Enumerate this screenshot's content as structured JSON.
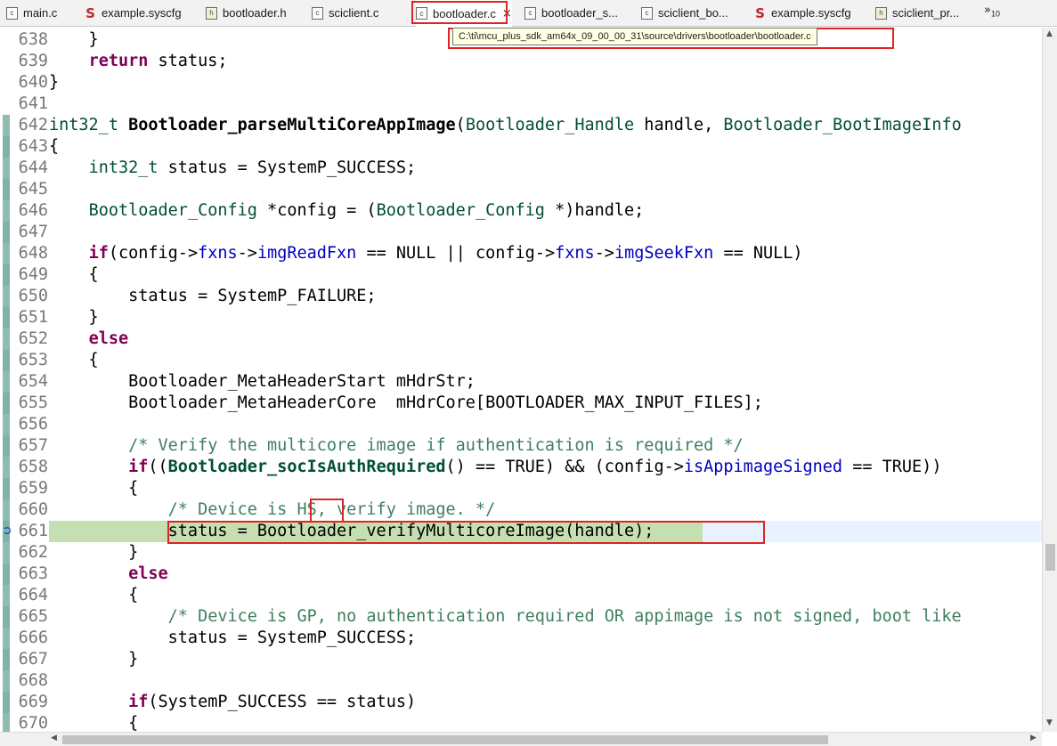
{
  "tabs": [
    {
      "label": "main.c",
      "icon": "c-file-icon"
    },
    {
      "label": "example.syscfg",
      "icon": "syscfg-icon"
    },
    {
      "label": "bootloader.h",
      "icon": "h-file-icon"
    },
    {
      "label": "sciclient.c",
      "icon": "c-file-icon"
    },
    {
      "label": "bootloader.c",
      "icon": "c-file-icon",
      "active": true,
      "close": "×"
    },
    {
      "label": "bootloader_s...",
      "icon": "c-file-icon"
    },
    {
      "label": "sciclient_bo...",
      "icon": "c-file-icon"
    },
    {
      "label": "example.syscfg",
      "icon": "syscfg-icon"
    },
    {
      "label": "sciclient_pr...",
      "icon": "h-file-icon"
    }
  ],
  "tab_overflow": {
    "glyph": "»",
    "count": "10"
  },
  "tooltip": "C:\\ti\\mcu_plus_sdk_am64x_09_00_00_31\\source\\drivers\\bootloader\\bootloader.c",
  "colors": {
    "annotation_red": "#e02424",
    "keyword": "#7f0055",
    "type": "#005032",
    "field": "#0000c0",
    "comment": "#3f7f5f",
    "debug_line": "#c6dfb0",
    "current_line": "#e8f2fe"
  },
  "editor": {
    "current_line": "661",
    "lines": [
      {
        "n": "638",
        "code": "    }"
      },
      {
        "n": "639",
        "code": "    return status;"
      },
      {
        "n": "640",
        "code": "}"
      },
      {
        "n": "641",
        "code": ""
      },
      {
        "n": "642",
        "code": "int32_t Bootloader_parseMultiCoreAppImage(Bootloader_Handle handle, Bootloader_BootImageInfo"
      },
      {
        "n": "643",
        "code": "{"
      },
      {
        "n": "644",
        "code": "    int32_t status = SystemP_SUCCESS;"
      },
      {
        "n": "645",
        "code": ""
      },
      {
        "n": "646",
        "code": "    Bootloader_Config *config = (Bootloader_Config *)handle;"
      },
      {
        "n": "647",
        "code": ""
      },
      {
        "n": "648",
        "code": "    if(config->fxns->imgReadFxn == NULL || config->fxns->imgSeekFxn == NULL)"
      },
      {
        "n": "649",
        "code": "    {"
      },
      {
        "n": "650",
        "code": "        status = SystemP_FAILURE;"
      },
      {
        "n": "651",
        "code": "    }"
      },
      {
        "n": "652",
        "code": "    else"
      },
      {
        "n": "653",
        "code": "    {"
      },
      {
        "n": "654",
        "code": "        Bootloader_MetaHeaderStart mHdrStr;"
      },
      {
        "n": "655",
        "code": "        Bootloader_MetaHeaderCore  mHdrCore[BOOTLOADER_MAX_INPUT_FILES];"
      },
      {
        "n": "656",
        "code": ""
      },
      {
        "n": "657",
        "code": "        /* Verify the multicore image if authentication is required */"
      },
      {
        "n": "658",
        "code": "        if((Bootloader_socIsAuthRequired() == TRUE) && (config->isAppimageSigned == TRUE))"
      },
      {
        "n": "659",
        "code": "        {"
      },
      {
        "n": "660",
        "code": "            /* Device is HS, verify image. */"
      },
      {
        "n": "661",
        "code": "            status = Bootloader_verifyMulticoreImage(handle);"
      },
      {
        "n": "662",
        "code": "        }"
      },
      {
        "n": "663",
        "code": "        else"
      },
      {
        "n": "664",
        "code": "        {"
      },
      {
        "n": "665",
        "code": "            /* Device is GP, no authentication required OR appimage is not signed, boot like"
      },
      {
        "n": "666",
        "code": "            status = SystemP_SUCCESS;"
      },
      {
        "n": "667",
        "code": "        }"
      },
      {
        "n": "668",
        "code": ""
      },
      {
        "n": "669",
        "code": "        if(SystemP_SUCCESS == status)"
      },
      {
        "n": "670",
        "code": "        {"
      }
    ]
  }
}
